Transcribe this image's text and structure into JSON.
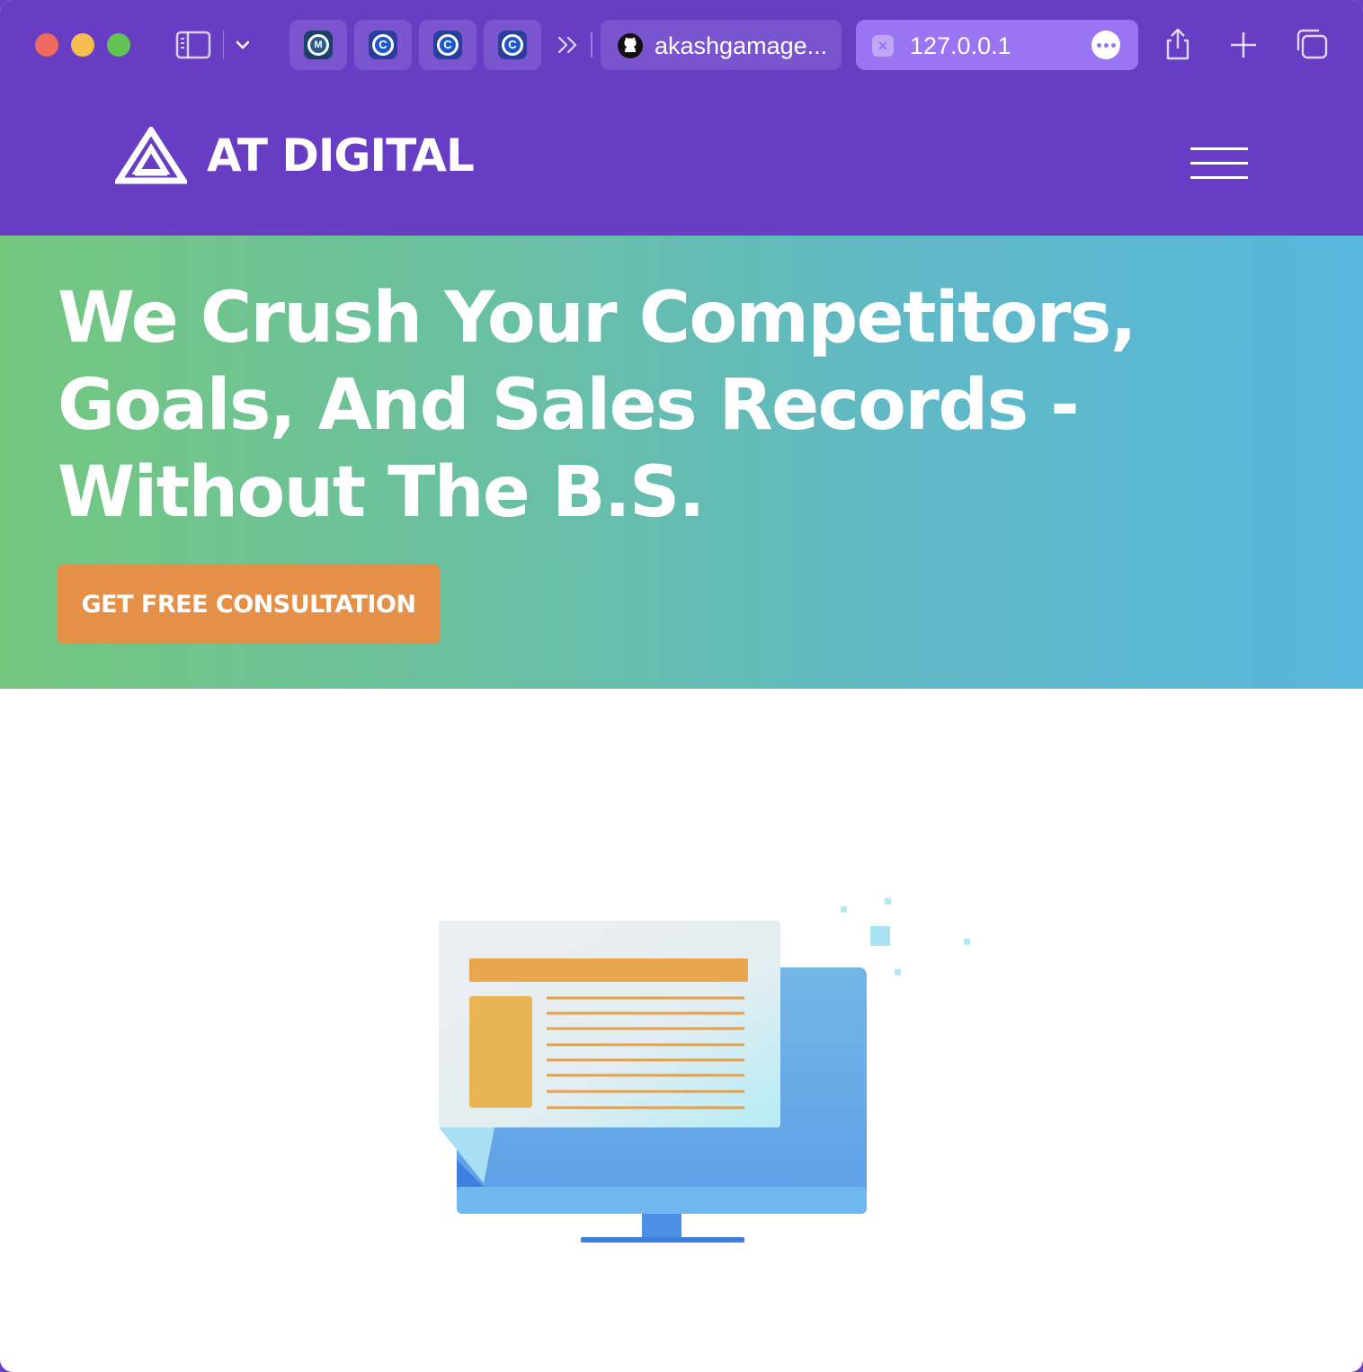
{
  "browser": {
    "pinned_tabs": [
      {
        "icon": "monitor-favicon-icon",
        "glyph": "M"
      },
      {
        "icon": "c-favicon-icon",
        "glyph": "C"
      },
      {
        "icon": "c-favicon-icon",
        "glyph": "C"
      },
      {
        "icon": "c-favicon-icon",
        "glyph": "C"
      }
    ],
    "tabs": [
      {
        "title": "akashgamage...",
        "icon": "github-icon"
      },
      {
        "title": "127.0.0.1",
        "icon": "close-icon",
        "active": true
      }
    ]
  },
  "site": {
    "logo_text": "AT DIGITAL"
  },
  "hero": {
    "title": "We Crush Your Competitors, Goals, And Sales Records - Without The B.S.",
    "cta_label": "GET FREE CONSULTATION"
  },
  "colors": {
    "toolbar": "#673dc3",
    "header": "#673dc3",
    "hero_gradient_start": "#74c77e",
    "hero_gradient_end": "#59b6dd",
    "cta": "#e59049"
  }
}
